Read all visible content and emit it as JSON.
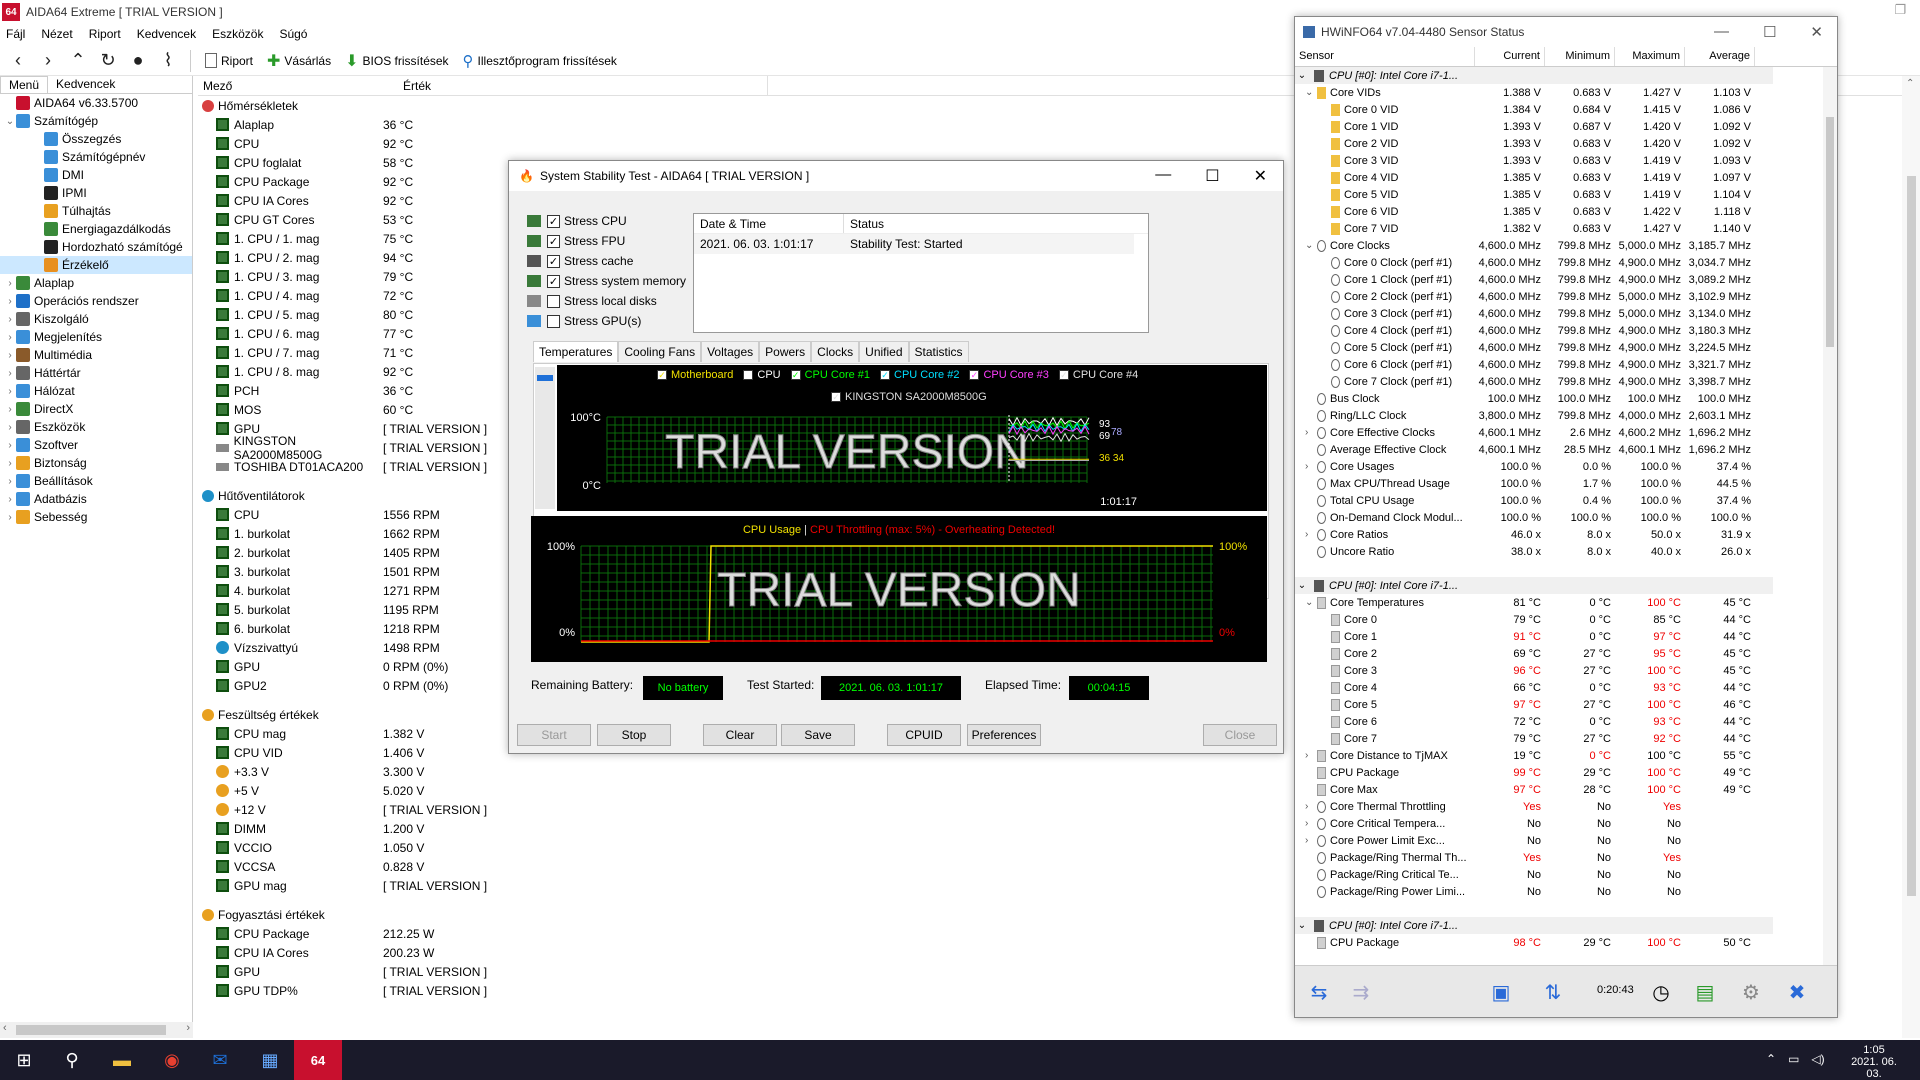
{
  "aida": {
    "title": "AIDA64 Extreme  [ TRIAL VERSION ]",
    "logo": "64",
    "menu": [
      "Fájl",
      "Nézet",
      "Riport",
      "Kedvencek",
      "Eszközök",
      "Súgó"
    ],
    "toolbar": {
      "report": "Riport",
      "buy": "Vásárlás",
      "bios": "BIOS frissítések",
      "driver": "Illesztőprogram frissítések"
    },
    "tabs": [
      "Menü",
      "Kedvencek"
    ],
    "tree": [
      {
        "label": "AIDA64 v6.33.5700",
        "lvl": 0,
        "ex": "",
        "c": "#c8102e"
      },
      {
        "label": "Számítógép",
        "lvl": 0,
        "ex": "⌄",
        "c": "#3a8fd8"
      },
      {
        "label": "Összegzés",
        "lvl": 2,
        "ex": "",
        "c": "#3a8fd8"
      },
      {
        "label": "Számítógépnév",
        "lvl": 2,
        "ex": "",
        "c": "#3a8fd8"
      },
      {
        "label": "DMI",
        "lvl": 2,
        "ex": "",
        "c": "#3a8fd8"
      },
      {
        "label": "IPMI",
        "lvl": 2,
        "ex": "",
        "c": "#222"
      },
      {
        "label": "Túlhajtás",
        "lvl": 2,
        "ex": "",
        "c": "#e8a020"
      },
      {
        "label": "Energiagazdálkodás",
        "lvl": 2,
        "ex": "",
        "c": "#3a8a3a"
      },
      {
        "label": "Hordozható számítógé",
        "lvl": 2,
        "ex": "",
        "c": "#222"
      },
      {
        "label": "Érzékelő",
        "lvl": 2,
        "ex": "",
        "c": "#e89020"
      },
      {
        "label": "Alaplap",
        "lvl": 0,
        "ex": "›",
        "c": "#3a8a3a"
      },
      {
        "label": "Operációs rendszer",
        "lvl": 0,
        "ex": "›",
        "c": "#1e70c8"
      },
      {
        "label": "Kiszolgáló",
        "lvl": 0,
        "ex": "›",
        "c": "#666"
      },
      {
        "label": "Megjelenítés",
        "lvl": 0,
        "ex": "›",
        "c": "#3a8fd8"
      },
      {
        "label": "Multimédia",
        "lvl": 0,
        "ex": "›",
        "c": "#8a5a2a"
      },
      {
        "label": "Háttértár",
        "lvl": 0,
        "ex": "›",
        "c": "#666"
      },
      {
        "label": "Hálózat",
        "lvl": 0,
        "ex": "›",
        "c": "#3a8fd8"
      },
      {
        "label": "DirectX",
        "lvl": 0,
        "ex": "›",
        "c": "#3a8a3a"
      },
      {
        "label": "Eszközök",
        "lvl": 0,
        "ex": "›",
        "c": "#666"
      },
      {
        "label": "Szoftver",
        "lvl": 0,
        "ex": "›",
        "c": "#3a8fd8"
      },
      {
        "label": "Biztonság",
        "lvl": 0,
        "ex": "›",
        "c": "#e8a020"
      },
      {
        "label": "Beállítások",
        "lvl": 0,
        "ex": "›",
        "c": "#3a8fd8"
      },
      {
        "label": "Adatbázis",
        "lvl": 0,
        "ex": "›",
        "c": "#3a8fd8"
      },
      {
        "label": "Sebesség",
        "lvl": 0,
        "ex": "›",
        "c": "#e8a020"
      }
    ],
    "columns": {
      "field": "Mező",
      "value": "Érték"
    },
    "groups": [
      {
        "title": "Hőmérsékletek",
        "icon": "thermometer-icon",
        "rows": [
          [
            "Alaplap",
            "36 °C",
            "chip"
          ],
          [
            "CPU",
            "92 °C",
            "chip"
          ],
          [
            "CPU foglalat",
            "58 °C",
            "chip"
          ],
          [
            "CPU Package",
            "92 °C",
            "chip"
          ],
          [
            "CPU IA Cores",
            "92 °C",
            "chip"
          ],
          [
            "CPU GT Cores",
            "53 °C",
            "chip"
          ],
          [
            "1. CPU / 1. mag",
            "75 °C",
            "chip"
          ],
          [
            "1. CPU / 2. mag",
            "94 °C",
            "chip"
          ],
          [
            "1. CPU / 3. mag",
            "79 °C",
            "chip"
          ],
          [
            "1. CPU / 4. mag",
            "72 °C",
            "chip"
          ],
          [
            "1. CPU / 5. mag",
            "80 °C",
            "chip"
          ],
          [
            "1. CPU / 6. mag",
            "77 °C",
            "chip"
          ],
          [
            "1. CPU / 7. mag",
            "71 °C",
            "chip"
          ],
          [
            "1. CPU / 8. mag",
            "92 °C",
            "chip"
          ],
          [
            "PCH",
            "36 °C",
            "chip"
          ],
          [
            "MOS",
            "60 °C",
            "chip"
          ],
          [
            "GPU",
            "[ TRIAL VERSION ]",
            "chip"
          ],
          [
            "KINGSTON SA2000M8500G",
            "[ TRIAL VERSION ]",
            "disk"
          ],
          [
            "TOSHIBA DT01ACA200",
            "[ TRIAL VERSION ]",
            "disk"
          ]
        ]
      },
      {
        "title": "Hűtőventilátorok",
        "icon": "fan-icon",
        "rows": [
          [
            "CPU",
            "1556 RPM",
            "chip"
          ],
          [
            "1. burkolat",
            "1662 RPM",
            "chip"
          ],
          [
            "2. burkolat",
            "1405 RPM",
            "chip"
          ],
          [
            "3. burkolat",
            "1501 RPM",
            "chip"
          ],
          [
            "4. burkolat",
            "1271 RPM",
            "chip"
          ],
          [
            "5. burkolat",
            "1195 RPM",
            "chip"
          ],
          [
            "6. burkolat",
            "1218 RPM",
            "chip"
          ],
          [
            "Vízszivattyú",
            "1498 RPM",
            "fan"
          ],
          [
            "GPU",
            "0 RPM  (0%)",
            "chip"
          ],
          [
            "GPU2",
            "0 RPM  (0%)",
            "chip"
          ]
        ]
      },
      {
        "title": "Feszültség értékek",
        "icon": "voltage-icon",
        "rows": [
          [
            "CPU mag",
            "1.382 V",
            "chip"
          ],
          [
            "CPU VID",
            "1.406 V",
            "chip"
          ],
          [
            "+3.3 V",
            "3.300 V",
            "volt"
          ],
          [
            "+5 V",
            "5.020 V",
            "volt"
          ],
          [
            "+12 V",
            "[ TRIAL VERSION ]",
            "volt"
          ],
          [
            "DIMM",
            "1.200 V",
            "chip"
          ],
          [
            "VCCIO",
            "1.050 V",
            "chip"
          ],
          [
            "VCCSA",
            "0.828 V",
            "chip"
          ],
          [
            "GPU mag",
            "[ TRIAL VERSION ]",
            "chip"
          ]
        ]
      },
      {
        "title": "Fogyasztási értékek",
        "icon": "power-icon",
        "rows": [
          [
            "CPU Package",
            "212.25 W",
            "chip"
          ],
          [
            "CPU IA Cores",
            "200.23 W",
            "chip"
          ],
          [
            "GPU",
            "[ TRIAL VERSION ]",
            "chip"
          ],
          [
            "GPU TDP%",
            "[ TRIAL VERSION ]",
            "chip"
          ]
        ]
      }
    ]
  },
  "sst": {
    "title": "System Stability Test - AIDA64  [ TRIAL VERSION ]",
    "stress": [
      [
        "Stress CPU",
        true
      ],
      [
        "Stress FPU",
        true
      ],
      [
        "Stress cache",
        true
      ],
      [
        "Stress system memory",
        true
      ],
      [
        "Stress local disks",
        false
      ],
      [
        "Stress GPU(s)",
        false
      ]
    ],
    "status_head": {
      "date": "Date & Time",
      "status": "Status"
    },
    "status_row": {
      "date": "2021. 06. 03. 1:01:17",
      "status": "Stability Test: Started"
    },
    "tabs": [
      "Temperatures",
      "Cooling Fans",
      "Voltages",
      "Powers",
      "Clocks",
      "Unified",
      "Statistics"
    ],
    "legend": [
      [
        "Motherboard",
        "#f0e000"
      ],
      [
        "CPU",
        "#ffffff"
      ],
      [
        "CPU Core #1",
        "#00ff00"
      ],
      [
        "CPU Core #2",
        "#00e0ff"
      ],
      [
        "CPU Core #3",
        "#ff40ff"
      ],
      [
        "CPU Core #4",
        "#e0e0e0"
      ]
    ],
    "legend2": "KINGSTON SA2000M8500G",
    "temp_y_top": "100°C",
    "temp_y_bot": "0°C",
    "time_label": "1:01:17",
    "temp_vals": [
      "93",
      "69",
      "36 34"
    ],
    "temp_vals_extra": "78",
    "watermark": "TRIAL VERSION",
    "usage_title": "CPU Usage",
    "usage_sep": "|",
    "usage_warn": "CPU Throttling (max: 5%) - Overheating Detected!",
    "usage_100": "100%",
    "usage_0": "0%",
    "usage_r100": "100%",
    "usage_r0": "0%",
    "battery_label": "Remaining Battery:",
    "battery": "No battery",
    "started_label": "Test Started:",
    "started": "2021. 06. 03. 1:01:17",
    "elapsed_label": "Elapsed Time:",
    "elapsed": "00:04:15",
    "buttons": {
      "start": "Start",
      "stop": "Stop",
      "clear": "Clear",
      "save": "Save",
      "cpuid": "CPUID",
      "prefs": "Preferences",
      "close": "Close"
    }
  },
  "hw": {
    "title": "HWiNFO64 v7.04-4480 Sensor Status",
    "cols": [
      "Sensor",
      "Current",
      "Minimum",
      "Maximum",
      "Average"
    ],
    "rows": [
      {
        "s": 1,
        "n": "CPU [#0]: Intel Core i7-1..."
      },
      {
        "i": 1,
        "ex": "⌄",
        "n": "Core VIDs",
        "v": [
          "1.388 V",
          "0.683 V",
          "1.427 V",
          "1.103 V"
        ]
      },
      {
        "i": 2,
        "n": "Core 0 VID",
        "v": [
          "1.384 V",
          "0.684 V",
          "1.415 V",
          "1.086 V"
        ]
      },
      {
        "i": 2,
        "n": "Core 1 VID",
        "v": [
          "1.393 V",
          "0.687 V",
          "1.420 V",
          "1.092 V"
        ]
      },
      {
        "i": 2,
        "n": "Core 2 VID",
        "v": [
          "1.393 V",
          "0.683 V",
          "1.420 V",
          "1.092 V"
        ]
      },
      {
        "i": 2,
        "n": "Core 3 VID",
        "v": [
          "1.393 V",
          "0.683 V",
          "1.419 V",
          "1.093 V"
        ]
      },
      {
        "i": 2,
        "n": "Core 4 VID",
        "v": [
          "1.385 V",
          "0.683 V",
          "1.419 V",
          "1.097 V"
        ]
      },
      {
        "i": 2,
        "n": "Core 5 VID",
        "v": [
          "1.385 V",
          "0.683 V",
          "1.419 V",
          "1.104 V"
        ]
      },
      {
        "i": 2,
        "n": "Core 6 VID",
        "v": [
          "1.385 V",
          "0.683 V",
          "1.422 V",
          "1.118 V"
        ]
      },
      {
        "i": 2,
        "n": "Core 7 VID",
        "v": [
          "1.382 V",
          "0.683 V",
          "1.427 V",
          "1.140 V"
        ]
      },
      {
        "i": 1,
        "ex": "⌄",
        "n": "Core Clocks",
        "v": [
          "4,600.0 MHz",
          "799.8 MHz",
          "5,000.0 MHz",
          "3,185.7 MHz"
        ]
      },
      {
        "i": 2,
        "n": "Core 0 Clock (perf #1)",
        "v": [
          "4,600.0 MHz",
          "799.8 MHz",
          "4,900.0 MHz",
          "3,034.7 MHz"
        ]
      },
      {
        "i": 2,
        "n": "Core 1 Clock (perf #1)",
        "v": [
          "4,600.0 MHz",
          "799.8 MHz",
          "4,900.0 MHz",
          "3,089.2 MHz"
        ]
      },
      {
        "i": 2,
        "n": "Core 2 Clock (perf #1)",
        "v": [
          "4,600.0 MHz",
          "799.8 MHz",
          "5,000.0 MHz",
          "3,102.9 MHz"
        ]
      },
      {
        "i": 2,
        "n": "Core 3 Clock (perf #1)",
        "v": [
          "4,600.0 MHz",
          "799.8 MHz",
          "5,000.0 MHz",
          "3,134.0 MHz"
        ]
      },
      {
        "i": 2,
        "n": "Core 4 Clock (perf #1)",
        "v": [
          "4,600.0 MHz",
          "799.8 MHz",
          "4,900.0 MHz",
          "3,180.3 MHz"
        ]
      },
      {
        "i": 2,
        "n": "Core 5 Clock (perf #1)",
        "v": [
          "4,600.0 MHz",
          "799.8 MHz",
          "4,900.0 MHz",
          "3,224.5 MHz"
        ]
      },
      {
        "i": 2,
        "n": "Core 6 Clock (perf #1)",
        "v": [
          "4,600.0 MHz",
          "799.8 MHz",
          "4,900.0 MHz",
          "3,321.7 MHz"
        ]
      },
      {
        "i": 2,
        "n": "Core 7 Clock (perf #1)",
        "v": [
          "4,600.0 MHz",
          "799.8 MHz",
          "4,900.0 MHz",
          "3,398.7 MHz"
        ]
      },
      {
        "i": 0,
        "n": "Bus Clock",
        "v": [
          "100.0 MHz",
          "100.0 MHz",
          "100.0 MHz",
          "100.0 MHz"
        ]
      },
      {
        "i": 0,
        "n": "Ring/LLC Clock",
        "v": [
          "3,800.0 MHz",
          "799.8 MHz",
          "4,000.0 MHz",
          "2,603.1 MHz"
        ]
      },
      {
        "i": 1,
        "ex": "›",
        "n": "Core Effective Clocks",
        "v": [
          "4,600.1 MHz",
          "2.6 MHz",
          "4,600.2 MHz",
          "1,696.2 MHz"
        ]
      },
      {
        "i": 0,
        "n": "Average Effective Clock",
        "v": [
          "4,600.1 MHz",
          "28.5 MHz",
          "4,600.1 MHz",
          "1,696.2 MHz"
        ]
      },
      {
        "i": 1,
        "ex": "›",
        "n": "Core Usages",
        "v": [
          "100.0 %",
          "0.0 %",
          "100.0 %",
          "37.4 %"
        ]
      },
      {
        "i": 0,
        "n": "Max CPU/Thread Usage",
        "v": [
          "100.0 %",
          "1.7 %",
          "100.0 %",
          "44.5 %"
        ]
      },
      {
        "i": 0,
        "n": "Total CPU Usage",
        "v": [
          "100.0 %",
          "0.4 %",
          "100.0 %",
          "37.4 %"
        ]
      },
      {
        "i": 0,
        "n": "On-Demand Clock Modul...",
        "v": [
          "100.0 %",
          "100.0 %",
          "100.0 %",
          "100.0 %"
        ]
      },
      {
        "i": 1,
        "ex": "›",
        "n": "Core Ratios",
        "v": [
          "46.0 x",
          "8.0 x",
          "50.0 x",
          "31.9 x"
        ]
      },
      {
        "i": 0,
        "n": "Uncore Ratio",
        "v": [
          "38.0 x",
          "8.0 x",
          "40.0 x",
          "26.0 x"
        ]
      },
      {
        "blank": 1
      },
      {
        "s": 1,
        "n": "CPU [#0]: Intel Core i7-1..."
      },
      {
        "i": 1,
        "ex": "⌄",
        "n": "Core Temperatures",
        "v": [
          "81 °C",
          "0 °C",
          "100 °C",
          "45 °C"
        ],
        "r": [
          0,
          0,
          1,
          0
        ]
      },
      {
        "i": 2,
        "n": "Core 0",
        "v": [
          "79 °C",
          "0 °C",
          "85 °C",
          "44 °C"
        ],
        "r": [
          0,
          0,
          0,
          0
        ]
      },
      {
        "i": 2,
        "n": "Core 1",
        "v": [
          "91 °C",
          "0 °C",
          "97 °C",
          "44 °C"
        ],
        "r": [
          1,
          0,
          1,
          0
        ]
      },
      {
        "i": 2,
        "n": "Core 2",
        "v": [
          "69 °C",
          "27 °C",
          "95 °C",
          "45 °C"
        ],
        "r": [
          0,
          0,
          1,
          0
        ]
      },
      {
        "i": 2,
        "n": "Core 3",
        "v": [
          "96 °C",
          "27 °C",
          "100 °C",
          "45 °C"
        ],
        "r": [
          1,
          0,
          1,
          0
        ]
      },
      {
        "i": 2,
        "n": "Core 4",
        "v": [
          "66 °C",
          "0 °C",
          "93 °C",
          "44 °C"
        ],
        "r": [
          0,
          0,
          1,
          0
        ]
      },
      {
        "i": 2,
        "n": "Core 5",
        "v": [
          "97 °C",
          "27 °C",
          "100 °C",
          "46 °C"
        ],
        "r": [
          1,
          0,
          1,
          0
        ]
      },
      {
        "i": 2,
        "n": "Core 6",
        "v": [
          "72 °C",
          "0 °C",
          "93 °C",
          "44 °C"
        ],
        "r": [
          0,
          0,
          1,
          0
        ]
      },
      {
        "i": 2,
        "n": "Core 7",
        "v": [
          "79 °C",
          "27 °C",
          "92 °C",
          "44 °C"
        ],
        "r": [
          0,
          0,
          1,
          0
        ]
      },
      {
        "i": 1,
        "ex": "›",
        "n": "Core Distance to TjMAX",
        "v": [
          "19 °C",
          "0 °C",
          "100 °C",
          "55 °C"
        ],
        "r": [
          0,
          1,
          0,
          0
        ]
      },
      {
        "i": 0,
        "n": "CPU Package",
        "v": [
          "99 °C",
          "29 °C",
          "100 °C",
          "49 °C"
        ],
        "r": [
          1,
          0,
          1,
          0
        ]
      },
      {
        "i": 0,
        "n": "Core Max",
        "v": [
          "97 °C",
          "28 °C",
          "100 °C",
          "49 °C"
        ],
        "r": [
          1,
          0,
          1,
          0
        ]
      },
      {
        "i": 1,
        "ex": "›",
        "n": "Core Thermal Throttling",
        "v": [
          "Yes",
          "No",
          "Yes",
          ""
        ],
        "r": [
          1,
          0,
          1,
          0
        ]
      },
      {
        "i": 1,
        "ex": "›",
        "n": "Core Critical Tempera...",
        "v": [
          "No",
          "No",
          "No",
          ""
        ]
      },
      {
        "i": 1,
        "ex": "›",
        "n": "Core Power Limit Exc...",
        "v": [
          "No",
          "No",
          "No",
          ""
        ]
      },
      {
        "i": 0,
        "n": "Package/Ring Thermal Th...",
        "v": [
          "Yes",
          "No",
          "Yes",
          ""
        ],
        "r": [
          1,
          0,
          1,
          0
        ]
      },
      {
        "i": 0,
        "n": "Package/Ring Critical Te...",
        "v": [
          "No",
          "No",
          "No",
          ""
        ]
      },
      {
        "i": 0,
        "n": "Package/Ring Power Limi...",
        "v": [
          "No",
          "No",
          "No",
          ""
        ]
      },
      {
        "blank": 1
      },
      {
        "s": 1,
        "n": "CPU [#0]: Intel Core i7-1..."
      },
      {
        "i": 0,
        "n": "CPU Package",
        "v": [
          "98 °C",
          "29 °C",
          "100 °C",
          "50 °C"
        ],
        "r": [
          1,
          0,
          1,
          0
        ]
      }
    ],
    "timer": "0:20:43"
  },
  "taskbar": {
    "time": "1:05",
    "date": "2021. 06. 03.",
    "active_app": "64"
  }
}
